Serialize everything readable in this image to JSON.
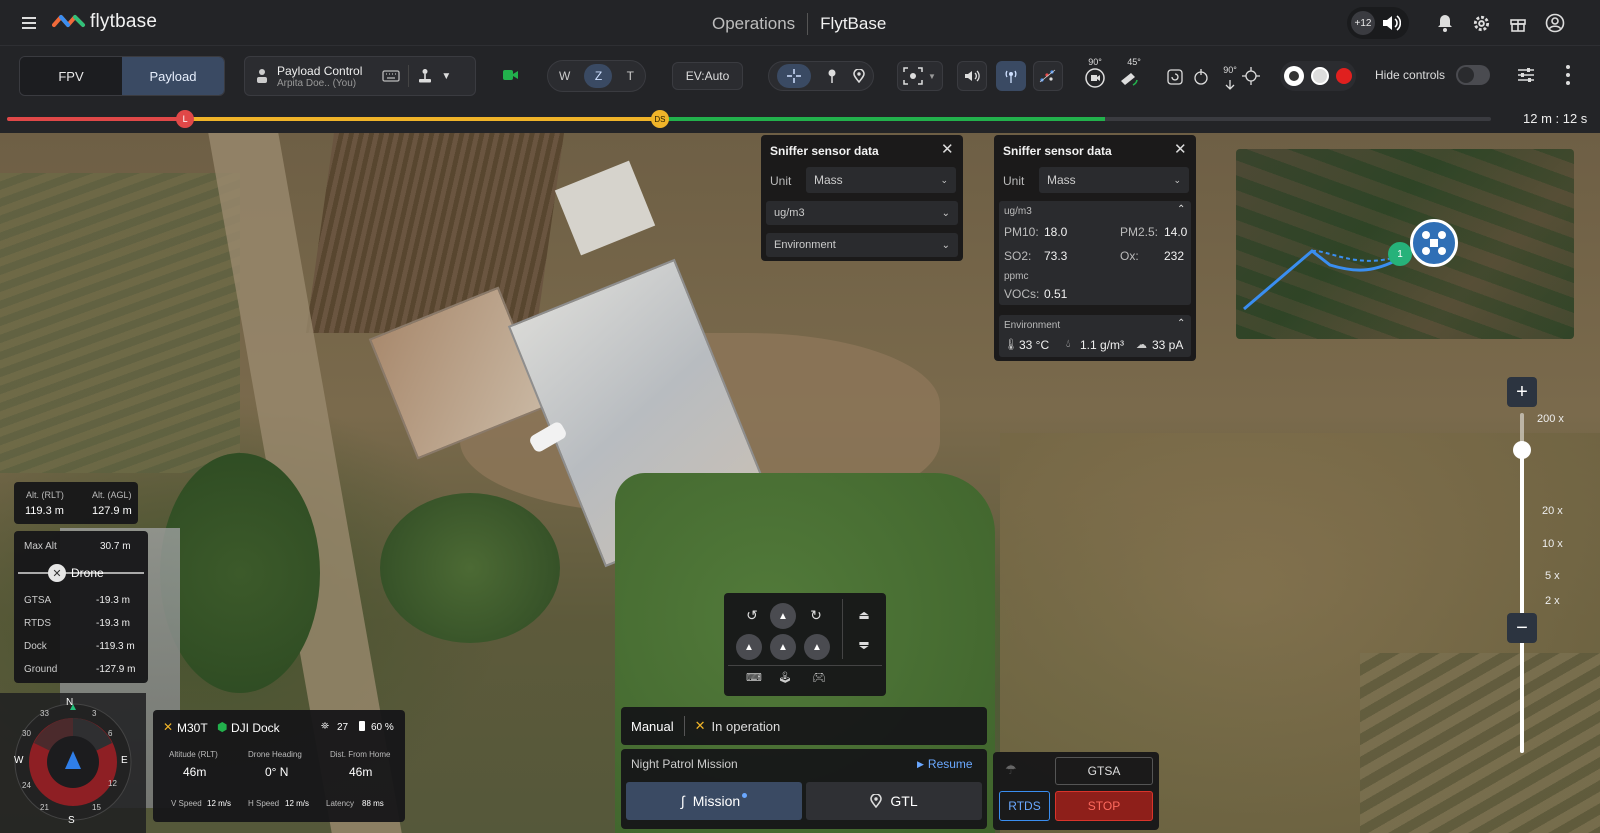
{
  "header": {
    "brand": "flytbase",
    "title_left": "Operations",
    "title_right": "FlytBase",
    "badge": "+12"
  },
  "toolbar": {
    "tab_fpv": "FPV",
    "tab_payload": "Payload",
    "payload_control_title": "Payload Control",
    "payload_control_user": "Arpita Doe.. (You)",
    "zoom_w": "W",
    "zoom_z": "Z",
    "zoom_t": "T",
    "ev": "EV:Auto",
    "gimbal_90": "90°",
    "gimbal_45": "45°",
    "gimbal_90b": "90°",
    "hide_controls": "Hide controls"
  },
  "timeline": {
    "marker_l": "L",
    "marker_ds": "DS",
    "time": "12 m : 12 s",
    "red_fraction": 0.12,
    "yellow_fraction": 0.44,
    "green_fraction": 0.74
  },
  "sniffer1": {
    "title": "Sniffer sensor data",
    "unit_label": "Unit",
    "unit_value": "Mass",
    "dd1": "ug/m3",
    "dd2": "Environment"
  },
  "sniffer2": {
    "title": "Sniffer sensor data",
    "unit_label": "Unit",
    "unit_value": "Mass",
    "section1": "ug/m3",
    "pm10_label": "PM10:",
    "pm10": "18.0",
    "pm25_label": "PM2.5:",
    "pm25": "14.0",
    "so2_label": "SO2:",
    "so2": "73.3",
    "ox_label": "Ox:",
    "ox": "232",
    "ppmc": "ppmc",
    "vocs_label": "VOCs:",
    "vocs": "0.51",
    "section2": "Environment",
    "temp": "33 °C",
    "hum": "1.1 g/m³",
    "curr": "33 pA"
  },
  "minimap": {
    "waypoint": "1"
  },
  "zoom": {
    "levels": [
      "200 x",
      "20 x",
      "10 x",
      "5 x",
      "2 x"
    ],
    "plus": "+",
    "minus": "−"
  },
  "altitude": {
    "rlt_label": "Alt. (RLT)",
    "rlt": "119.3 m",
    "agl_label": "Alt. (AGL)",
    "agl": "127.9 m",
    "max_label": "Max Alt",
    "max": "30.7 m",
    "drone": "Drone",
    "rows": [
      {
        "k": "GTSA",
        "v": "-19.3 m"
      },
      {
        "k": "RTDS",
        "v": "-19.3 m"
      },
      {
        "k": "Dock",
        "v": "-119.3 m"
      },
      {
        "k": "Ground",
        "v": "-127.9 m"
      }
    ]
  },
  "compass": {
    "n": "N",
    "e": "E",
    "s": "S",
    "w": "W",
    "t1": "33",
    "t2": "6",
    "t3": "12",
    "t4": "15",
    "t5": "21",
    "t6": "24",
    "t7": "30",
    "t8": "3"
  },
  "telemetry": {
    "drone": "M30T",
    "dock": "DJI Dock",
    "sats": "27",
    "battery": "60 %",
    "alt_label": "Altitude (RLT)",
    "alt": "46m",
    "head_label": "Drone Heading",
    "head": "0° N",
    "dist_label": "Dist. From Home",
    "dist": "46m",
    "vspeed_label": "V Speed",
    "vspeed": "12 m/s",
    "hspeed_label": "H Speed",
    "hspeed": "12 m/s",
    "latency_label": "Latency",
    "latency": "88 ms"
  },
  "mission": {
    "mode": "Manual",
    "status": "In operation",
    "name": "Night Patrol Mission",
    "resume": "Resume",
    "mission_btn": "Mission",
    "gtl_btn": "GTL"
  },
  "emergency": {
    "gtsa": "GTSA",
    "rtds": "RTDS",
    "stop": "STOP"
  },
  "colors": {
    "accent": "#2f6fb6",
    "red": "#e04848",
    "yellow": "#f0b429",
    "green": "#22b14c",
    "stop": "#d9342b"
  }
}
